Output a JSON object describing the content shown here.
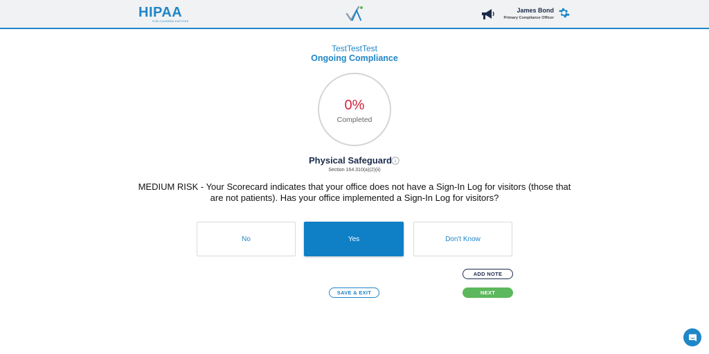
{
  "header": {
    "logo_text": "HIPAA",
    "logo_tagline": "FOR COVERED ENTITIES",
    "user_name": "James Bond",
    "user_role": "Primary Compliance Officer"
  },
  "page": {
    "org_name": "TestTestTest",
    "program_title": "Ongoing Compliance"
  },
  "progress": {
    "percent_label": "0%",
    "percent_value": 0,
    "status_label": "Completed"
  },
  "section": {
    "title": "Physical Safeguard",
    "reference": "Section 164.310(a)(2)(ii)"
  },
  "question": "MEDIUM RISK - Your Scorecard indicates that your office does not have a Sign-In Log for visitors (those that are not patients). Has your office implemented a Sign-In Log for visitors?",
  "answers": [
    {
      "label": "No",
      "selected": false
    },
    {
      "label": "Yes",
      "selected": true
    },
    {
      "label": "Don't Know",
      "selected": false
    }
  ],
  "actions": {
    "add_note": "ADD NOTE",
    "save_exit": "SAVE & EXIT",
    "next": "NEXT"
  },
  "colors": {
    "brand_blue": "#1f86c8",
    "risk_red": "#d2233b",
    "next_green": "#5cb85c",
    "navy": "#1b2b4a"
  },
  "icons": [
    "checkmark-logo-icon",
    "megaphone-icon",
    "gear-icon",
    "info-icon",
    "chat-icon"
  ]
}
